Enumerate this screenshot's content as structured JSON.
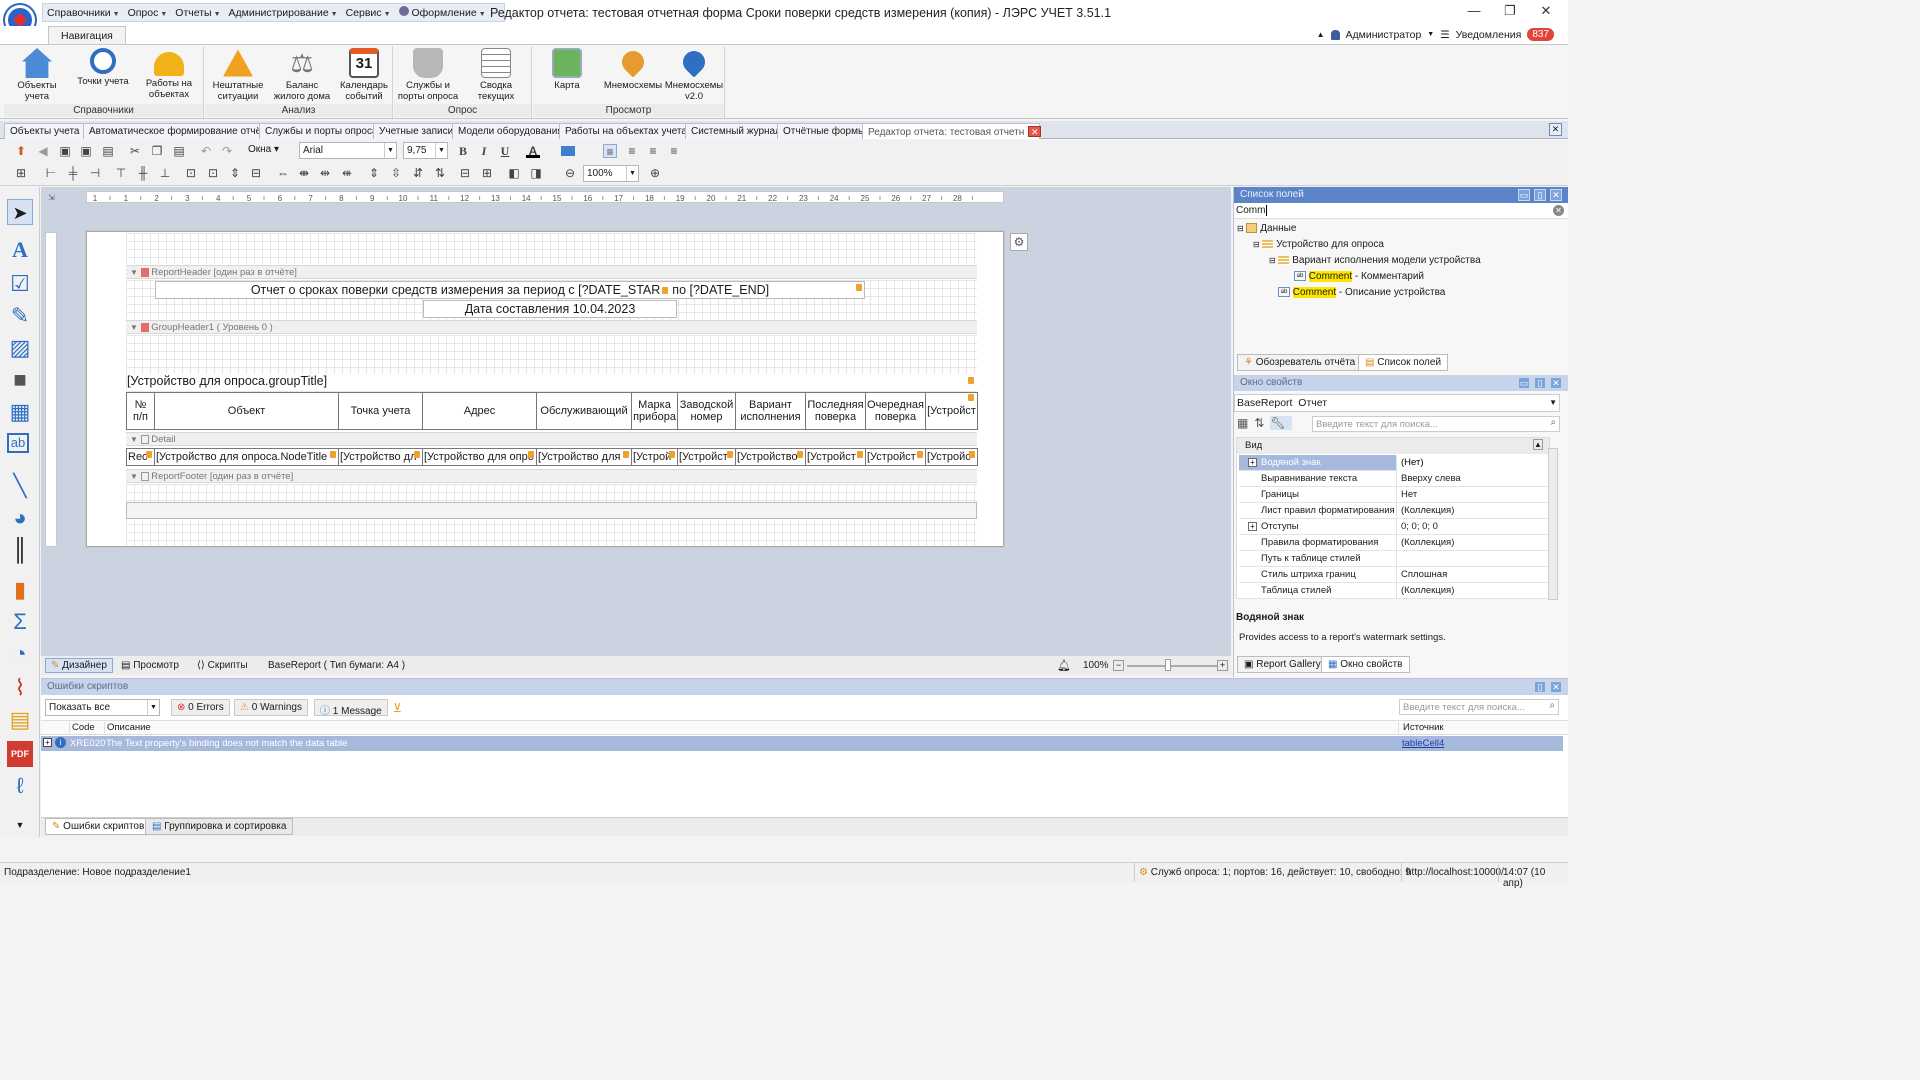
{
  "quick_menu": {
    "items": [
      "Справочники",
      "Опрос",
      "Отчеты",
      "Администрирование",
      "Сервис",
      "Оформление"
    ]
  },
  "window": {
    "title": "Редактор отчета: тестовая отчетная форма Сроки поверки средств измерения (копия) - ЛЭРС УЧЕТ 3.51.1",
    "minimize": "—",
    "restore": "❐",
    "close": "✕"
  },
  "ribbon_tab": "Навигация",
  "user": {
    "name": "Администратор",
    "notifications_label": "Уведомления",
    "notifications_count": "837"
  },
  "ribbon": {
    "groups": [
      {
        "label": "Справочники",
        "buttons": [
          "Объекты учета",
          "Точки учета",
          "Работы на объектах"
        ]
      },
      {
        "label": "Анализ",
        "buttons": [
          "Нештатные ситуации",
          "Баланс жилого дома",
          "Календарь событий"
        ]
      },
      {
        "label": "Опрос",
        "buttons": [
          "Службы и порты опроса",
          "Сводка текущих"
        ]
      },
      {
        "label": "Просмотр",
        "buttons": [
          "Карта",
          "Мнемосхемы",
          "Мнемосхемы v2.0"
        ]
      }
    ],
    "calendar_day": "31"
  },
  "doc_tabs": [
    "Объекты учета",
    "Автоматическое формирование отчёто",
    "Службы и порты опроса",
    "Учетные записи",
    "Модели оборудования",
    "Работы на объектах учета",
    "Системный журнал",
    "Отчётные формы",
    "Редактор отчета: тестовая отчетн"
  ],
  "toolbar": {
    "windows_label": "Окна",
    "font": "Arial",
    "font_size": "9,75",
    "zoom": "100%",
    "bold": "B",
    "italic": "I",
    "underline": "U",
    "font_color": "A"
  },
  "ruler": {
    "marks": [
      "1",
      "1",
      "2",
      "3",
      "4",
      "5",
      "6",
      "7",
      "8",
      "9",
      "10",
      "11",
      "12",
      "13",
      "14",
      "15",
      "16",
      "17",
      "18",
      "19",
      "20",
      "21",
      "22",
      "23",
      "24",
      "25",
      "26",
      "27",
      "28"
    ]
  },
  "report": {
    "report_header_band": "ReportHeader [один раз в отчёте]",
    "title": "Отчет о сроках поверки средств измерения за период с [?DATE_STAR",
    "title_to": "по [?DATE_END]",
    "date_line": "Дата составления 10.04.2023",
    "group_header_band": "GroupHeader1 ( Уровень 0 )",
    "group_title": "[Устройство для опроса.groupTitle]",
    "columns": [
      "№\nп/п",
      "Объект",
      "Точка учета",
      "Адрес",
      "Обслуживающий",
      "Марка\nприбора",
      "Заводской\nномер",
      "Вариант\nисполнения",
      "Последняя\nповерка",
      "Очередная\nповерка",
      "[Устройст"
    ],
    "detail_band": "Detail",
    "detail_cells": [
      "Rec",
      "[Устройство для опроса.NodeTitle -",
      "[Устройство дл",
      "[Устройство для опро",
      "[Устройство для",
      "[Устрой",
      "[Устройст",
      "[Устройство",
      "[Устройст",
      "[Устройст",
      "[Устройс"
    ],
    "report_footer_band": "ReportFooter [один раз в отчёте]"
  },
  "field_list": {
    "title": "Список полей",
    "search": "Comm",
    "tree": {
      "root": "Данные",
      "device": "Устройство для опроса",
      "variant": "Вариант исполнения модели устройства",
      "comment_hl": "Comment",
      "comment_rest": " - Комментарий",
      "desc_hl": "Comment",
      "desc_rest": " - Описание устройства"
    },
    "tabs": [
      "Обозреватель отчёта",
      "Список полей"
    ]
  },
  "properties": {
    "title": "Окно свойств",
    "object": "BaseReport",
    "object_type": "Отчет",
    "search_placeholder": "Введите текст для поиска...",
    "category": "Вид",
    "rows": [
      {
        "name": "Водяной знак",
        "value": "(Нет)"
      },
      {
        "name": "Выравнивание текста",
        "value": "Вверху слева"
      },
      {
        "name": "Границы",
        "value": "Нет"
      },
      {
        "name": "Лист правил форматирования",
        "value": "(Коллекция)"
      },
      {
        "name": "Отступы",
        "value": "0; 0; 0; 0"
      },
      {
        "name": "Правила форматирования",
        "value": "(Коллекция)"
      },
      {
        "name": "Путь к таблице стилей",
        "value": ""
      },
      {
        "name": "Стиль штриха границ",
        "value": "Сплошная"
      },
      {
        "name": "Таблица стилей",
        "value": "(Коллекция)"
      }
    ],
    "desc_title": "Водяной знак",
    "desc_text": "Provides access to a report's watermark settings.",
    "tabs": [
      "Report Gallery",
      "Окно свойств"
    ]
  },
  "design_bar": {
    "designer": "Дизайнер",
    "preview": "Просмотр",
    "scripts": "Скрипты",
    "report_info": "BaseReport ( Тип бумаги: A4 )",
    "zoom": "100%"
  },
  "errors": {
    "title": "Ошибки скриптов",
    "filter": "Показать все",
    "errors_chip": "0 Errors",
    "warnings_chip": "0 Warnings",
    "messages_chip": "1 Message",
    "search_placeholder": "Введите текст для поиска...",
    "columns": [
      "Code",
      "Описание",
      "Источник"
    ],
    "row": {
      "code": "XRE020",
      "description": "The Text property's binding does not match the data table",
      "source": "tableCell4"
    }
  },
  "bottom_tabs": [
    "Ошибки скриптов",
    "Группировка и сортировка"
  ],
  "status": {
    "left": "Подразделение: Новое подразделение1",
    "services": "Служб опроса: 1; портов: 16, действует: 10, свободно: 9",
    "url": "http://localhost:10000/",
    "time": "14:07 (10 апр)"
  }
}
